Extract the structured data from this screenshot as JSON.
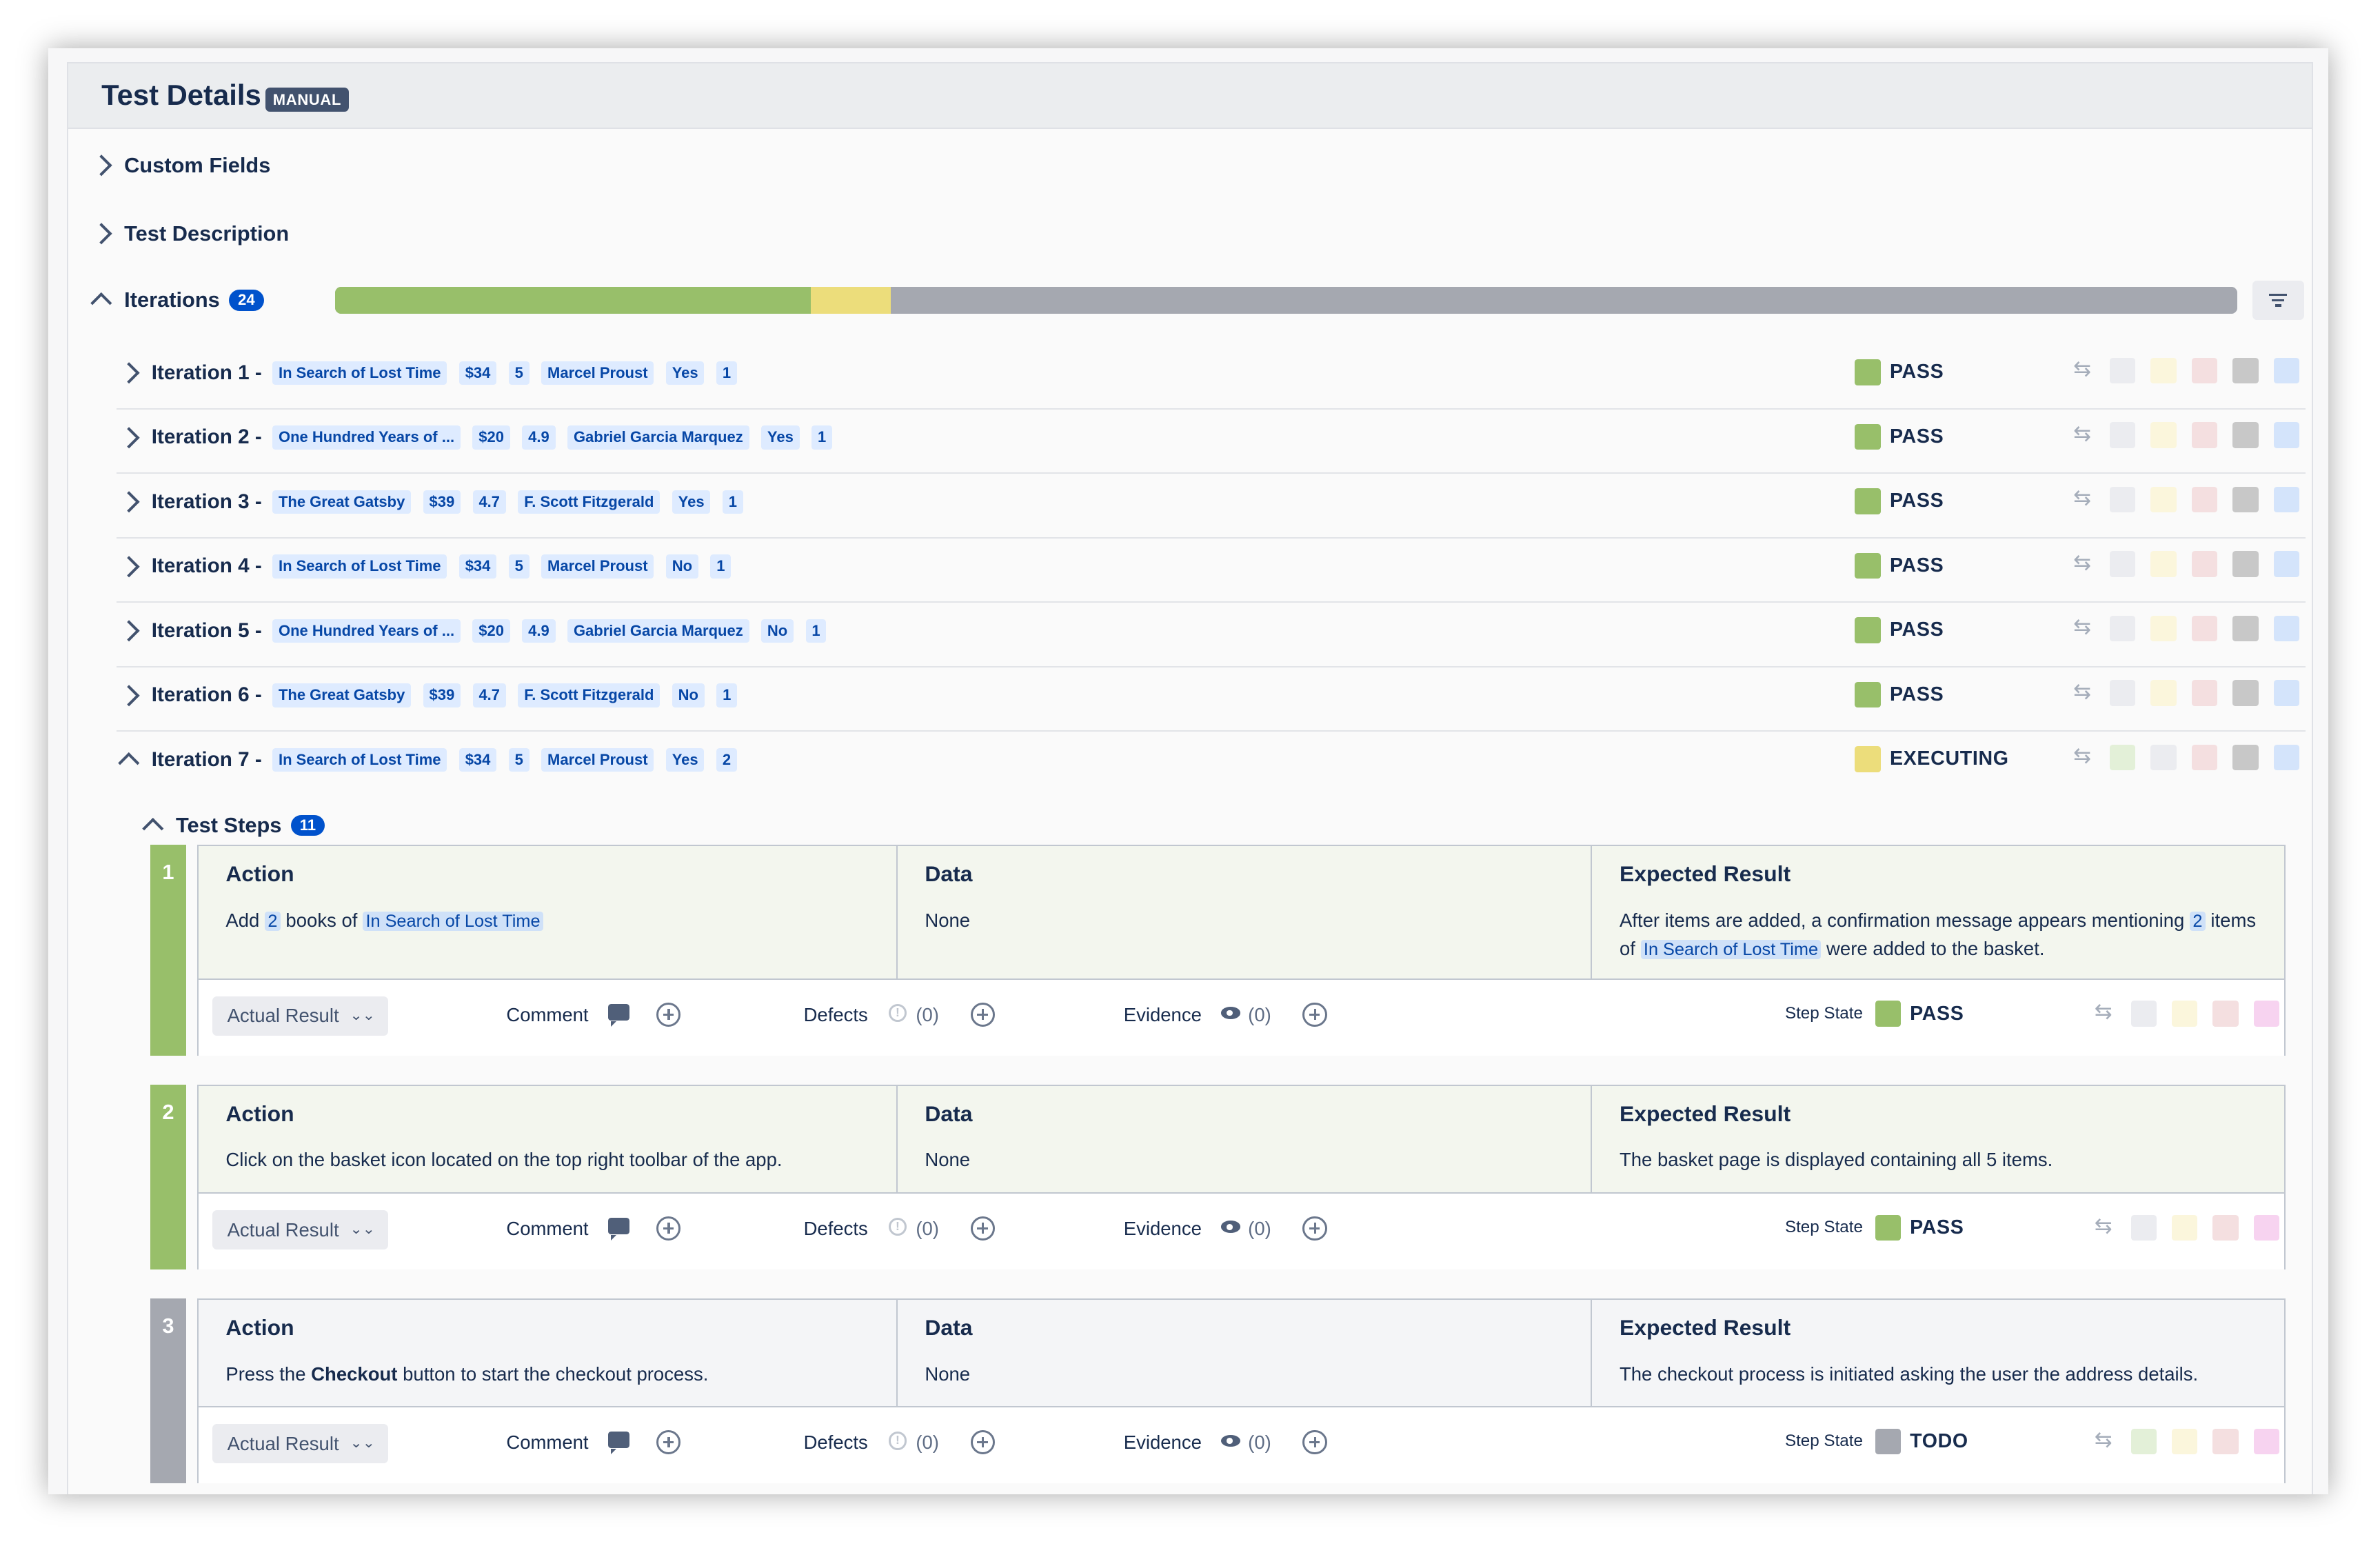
{
  "header": {
    "title": "Test Details",
    "badge": "MANUAL"
  },
  "sections": {
    "custom_fields": "Custom Fields",
    "test_description": "Test Description",
    "iterations_label": "Iterations",
    "iterations_count": "24"
  },
  "progress": {
    "pass_fraction": 0.25,
    "executing_fraction": 0.042,
    "todo_fraction": 0.708,
    "colors": {
      "pass": "#98bf6a",
      "executing": "#ecdd7b",
      "todo": "#a5a8b0"
    }
  },
  "iterations": [
    {
      "name": "Iteration 1 -",
      "tags": [
        "In Search of Lost Time",
        "$34",
        "5",
        "Marcel Proust",
        "Yes",
        "1"
      ],
      "status": "PASS",
      "expanded": false
    },
    {
      "name": "Iteration 2 -",
      "tags": [
        "One Hundred Years of ...",
        "$20",
        "4.9",
        "Gabriel Garcia Marquez",
        "Yes",
        "1"
      ],
      "status": "PASS",
      "expanded": false
    },
    {
      "name": "Iteration 3 -",
      "tags": [
        "The Great Gatsby",
        "$39",
        "4.7",
        "F. Scott Fitzgerald",
        "Yes",
        "1"
      ],
      "status": "PASS",
      "expanded": false
    },
    {
      "name": "Iteration 4 -",
      "tags": [
        "In Search of Lost Time",
        "$34",
        "5",
        "Marcel Proust",
        "No",
        "1"
      ],
      "status": "PASS",
      "expanded": false
    },
    {
      "name": "Iteration 5 -",
      "tags": [
        "One Hundred Years of ...",
        "$20",
        "4.9",
        "Gabriel Garcia Marquez",
        "No",
        "1"
      ],
      "status": "PASS",
      "expanded": false
    },
    {
      "name": "Iteration 6 -",
      "tags": [
        "The Great Gatsby",
        "$39",
        "4.7",
        "F. Scott Fitzgerald",
        "No",
        "1"
      ],
      "status": "PASS",
      "expanded": false
    },
    {
      "name": "Iteration 7 -",
      "tags": [
        "In Search of Lost Time",
        "$34",
        "5",
        "Marcel Proust",
        "Yes",
        "2"
      ],
      "status": "EXECUTING",
      "expanded": true
    }
  ],
  "status_colors": {
    "PASS": "#98bf6a",
    "EXECUTING": "#ecdd7b",
    "TODO": "#a5a8b0"
  },
  "test_steps": {
    "label": "Test Steps",
    "count": "11",
    "columns": {
      "action": "Action",
      "data": "Data",
      "expected": "Expected Result"
    },
    "bottom": {
      "actual_result": "Actual Result",
      "comment": "Comment",
      "defects": "Defects",
      "defects_count": "(0)",
      "evidence": "Evidence",
      "evidence_count": "(0)",
      "step_state": "Step State"
    },
    "steps": [
      {
        "number": "1",
        "action_parts": [
          "Add ",
          "2",
          " books of ",
          "In Search of Lost Time"
        ],
        "data": "None",
        "expected_parts": [
          "After items are added, a confirmation message appears mentioning ",
          "2",
          " items of ",
          "In Search of Lost Time",
          " were added to the basket."
        ],
        "state": "PASS"
      },
      {
        "number": "2",
        "action": "Click on the basket icon located on the top right toolbar of the app.",
        "data": "None",
        "expected": "The basket page is displayed containing all 5 items.",
        "state": "PASS"
      },
      {
        "number": "3",
        "action_parts": [
          "Press the ",
          "Checkout",
          " button to start the checkout process."
        ],
        "data": "None",
        "expected": "The checkout process is initiated asking the user the address details.",
        "state": "TODO"
      }
    ]
  }
}
